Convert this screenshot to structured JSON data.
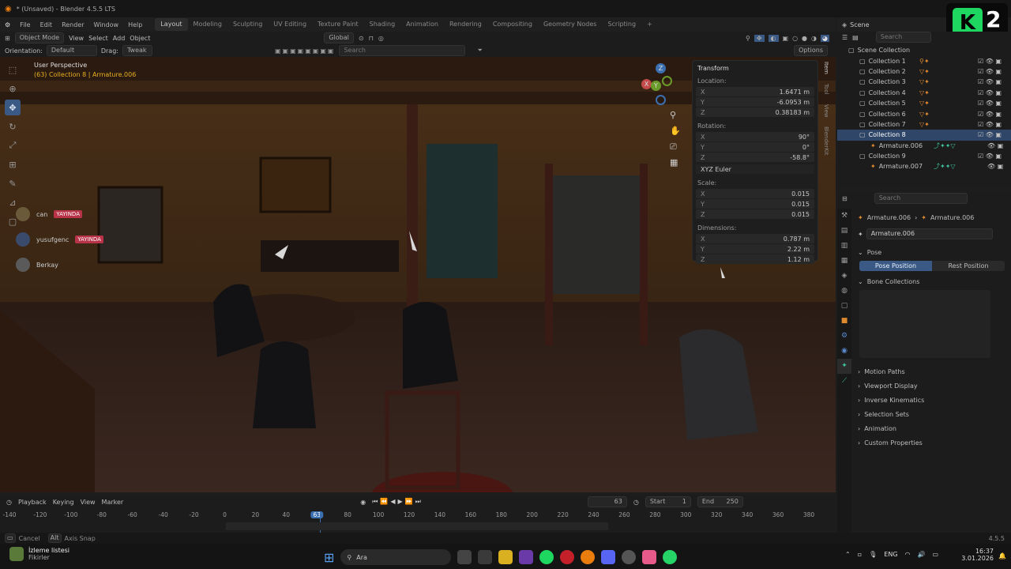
{
  "title": {
    "text": "* (Unsaved) - Blender 4.5.5 LTS"
  },
  "menu": [
    "File",
    "Edit",
    "Render",
    "Window",
    "Help"
  ],
  "workspaces": [
    "Layout",
    "Modeling",
    "Sculpting",
    "UV Editing",
    "Texture Paint",
    "Shading",
    "Animation",
    "Rendering",
    "Compositing",
    "Geometry Nodes",
    "Scripting"
  ],
  "scene": "Scene",
  "header": {
    "mode": "Object Mode",
    "view": "View",
    "select": "Select",
    "add": "Add",
    "object": "Object",
    "transform": "Global"
  },
  "header2": {
    "orientation_label": "Orientation:",
    "orientation": "Default",
    "drag_label": "Drag:",
    "drag": "Tweak",
    "search_placeholder": "Search",
    "options": "Options"
  },
  "viewport": {
    "perspective": "User Perspective",
    "collection_info": "(63) Collection 8 | Armature.006"
  },
  "stream_users": [
    {
      "name": "can",
      "badge": "YAYINDA"
    },
    {
      "name": "yusufgenc",
      "badge": "YAYINDA"
    },
    {
      "name": "Berkay",
      "badge": ""
    }
  ],
  "gizmo": {
    "x": "X",
    "y": "Y",
    "z": "Z"
  },
  "npanel": {
    "title": "Transform",
    "location_label": "Location:",
    "location": [
      {
        "axis": "X",
        "value": "1.6471 m"
      },
      {
        "axis": "Y",
        "value": "-6.0953 m"
      },
      {
        "axis": "Z",
        "value": "0.38183 m"
      }
    ],
    "rotation_label": "Rotation:",
    "rotation": [
      {
        "axis": "X",
        "value": "90°"
      },
      {
        "axis": "Y",
        "value": "0°"
      },
      {
        "axis": "Z",
        "value": "-58.8°"
      }
    ],
    "rotation_mode": "XYZ Euler",
    "scale_label": "Scale:",
    "scale": [
      {
        "axis": "X",
        "value": "0.015"
      },
      {
        "axis": "Y",
        "value": "0.015"
      },
      {
        "axis": "Z",
        "value": "0.015"
      }
    ],
    "dimensions_label": "Dimensions:",
    "dimensions": [
      {
        "axis": "X",
        "value": "0.787 m"
      },
      {
        "axis": "Y",
        "value": "2.22 m"
      },
      {
        "axis": "Z",
        "value": "1.12 m"
      }
    ],
    "tabs": [
      "Item",
      "Tool",
      "View",
      "BlenderKit"
    ]
  },
  "outliner": {
    "search_placeholder": "Search",
    "root": "Scene Collection",
    "items": [
      {
        "label": "Collection 1"
      },
      {
        "label": "Collection 2"
      },
      {
        "label": "Collection 3"
      },
      {
        "label": "Collection 4"
      },
      {
        "label": "Collection 5"
      },
      {
        "label": "Collection 6"
      },
      {
        "label": "Collection 7"
      },
      {
        "label": "Collection 8"
      },
      {
        "label": "Armature.006"
      },
      {
        "label": "Collection 9"
      },
      {
        "label": "Armature.007"
      }
    ]
  },
  "properties": {
    "search_placeholder": "Search",
    "breadcrumb_a": "Armature.006",
    "breadcrumb_b": "Armature.006",
    "data_name": "Armature.006",
    "pose_section": "Pose",
    "pose_position": "Pose Position",
    "rest_position": "Rest Position",
    "bone_collections": "Bone Collections",
    "sections": [
      "Motion Paths",
      "Viewport Display",
      "Inverse Kinematics",
      "Selection Sets",
      "Animation",
      "Custom Properties"
    ]
  },
  "timeline": {
    "playback": "Playback",
    "keying": "Keying",
    "view": "View",
    "marker": "Marker",
    "current_frame": "63",
    "start_label": "Start",
    "start": "1",
    "end_label": "End",
    "end": "250",
    "ticks": [
      "-140",
      "-120",
      "-100",
      "-80",
      "-60",
      "-40",
      "-20",
      "0",
      "20",
      "40",
      "63",
      "80",
      "100",
      "120",
      "140",
      "160",
      "180",
      "200",
      "220",
      "240",
      "260",
      "280",
      "300",
      "320",
      "340",
      "360",
      "380"
    ]
  },
  "status": {
    "cancel": "Cancel",
    "axis_snap": "Axis Snap",
    "version": "4.5.5"
  },
  "taskbar": {
    "news_title": "İzleme listesi",
    "news_sub": "Fikirler",
    "search": "Ara",
    "lang": "ENG",
    "time": "16:37",
    "date": "3.01.2026"
  },
  "badge": {
    "text": "2"
  },
  "colors": {
    "accent": "#3a5a85",
    "gizmo_x": "#c34a4a",
    "gizmo_y": "#6a9a2a",
    "gizmo_z": "#3b6fb0",
    "badge_green": "#1ed760",
    "yayinda": "#b83248"
  }
}
